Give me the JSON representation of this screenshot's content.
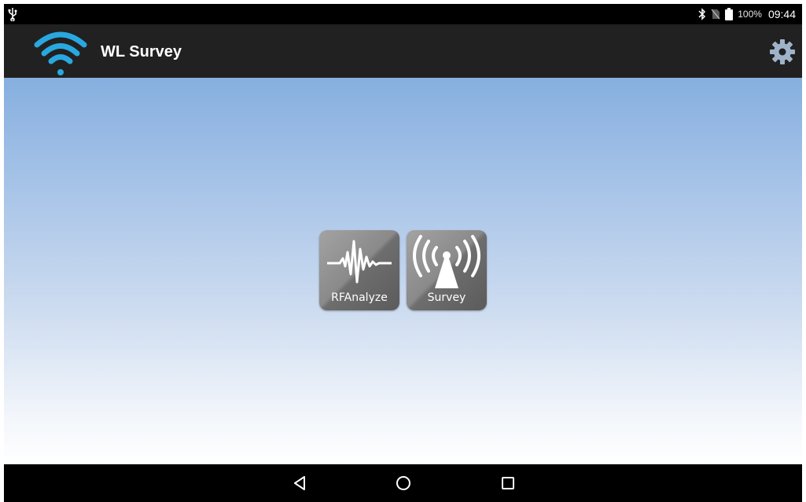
{
  "status_bar": {
    "battery_text": "100%",
    "time": "09:44",
    "icons": [
      "usb-icon",
      "bluetooth-icon",
      "no-sim-icon",
      "battery-icon"
    ]
  },
  "action_bar": {
    "title": "WL Survey",
    "logo_icon": "wifi-logo-icon",
    "settings_icon": "gear-icon"
  },
  "tiles": [
    {
      "label": "RFAnalyze",
      "icon": "waveform-icon"
    },
    {
      "label": "Survey",
      "icon": "antenna-icon"
    }
  ],
  "nav_bar": {
    "icons": [
      "back-triangle-icon",
      "home-circle-icon",
      "recents-square-icon"
    ]
  },
  "colors": {
    "action_bar": "#212121",
    "wifi_logo": "#29a8e0",
    "gear": "#9fb3c8",
    "content_top": "#86afdf",
    "content_bottom": "#ffffff"
  }
}
